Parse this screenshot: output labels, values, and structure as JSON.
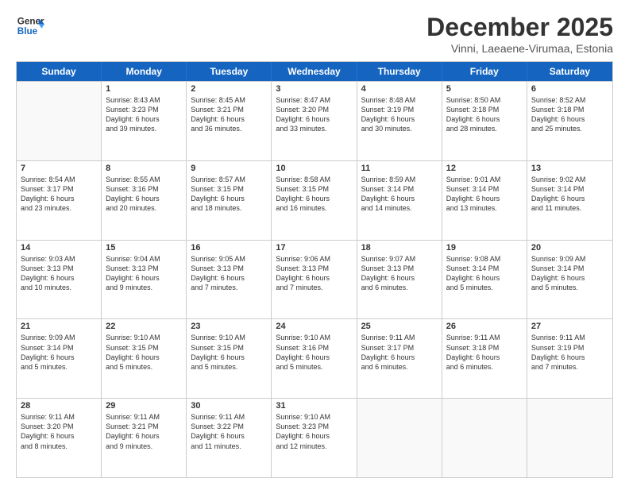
{
  "header": {
    "logo_line1": "General",
    "logo_line2": "Blue",
    "title": "December 2025",
    "subtitle": "Vinni, Laeaene-Virumaa, Estonia"
  },
  "calendar": {
    "weekdays": [
      "Sunday",
      "Monday",
      "Tuesday",
      "Wednesday",
      "Thursday",
      "Friday",
      "Saturday"
    ],
    "rows": [
      [
        {
          "day": "",
          "lines": [],
          "empty": true
        },
        {
          "day": "1",
          "lines": [
            "Sunrise: 8:43 AM",
            "Sunset: 3:23 PM",
            "Daylight: 6 hours",
            "and 39 minutes."
          ]
        },
        {
          "day": "2",
          "lines": [
            "Sunrise: 8:45 AM",
            "Sunset: 3:21 PM",
            "Daylight: 6 hours",
            "and 36 minutes."
          ]
        },
        {
          "day": "3",
          "lines": [
            "Sunrise: 8:47 AM",
            "Sunset: 3:20 PM",
            "Daylight: 6 hours",
            "and 33 minutes."
          ]
        },
        {
          "day": "4",
          "lines": [
            "Sunrise: 8:48 AM",
            "Sunset: 3:19 PM",
            "Daylight: 6 hours",
            "and 30 minutes."
          ]
        },
        {
          "day": "5",
          "lines": [
            "Sunrise: 8:50 AM",
            "Sunset: 3:18 PM",
            "Daylight: 6 hours",
            "and 28 minutes."
          ]
        },
        {
          "day": "6",
          "lines": [
            "Sunrise: 8:52 AM",
            "Sunset: 3:18 PM",
            "Daylight: 6 hours",
            "and 25 minutes."
          ]
        }
      ],
      [
        {
          "day": "7",
          "lines": [
            "Sunrise: 8:54 AM",
            "Sunset: 3:17 PM",
            "Daylight: 6 hours",
            "and 23 minutes."
          ]
        },
        {
          "day": "8",
          "lines": [
            "Sunrise: 8:55 AM",
            "Sunset: 3:16 PM",
            "Daylight: 6 hours",
            "and 20 minutes."
          ]
        },
        {
          "day": "9",
          "lines": [
            "Sunrise: 8:57 AM",
            "Sunset: 3:15 PM",
            "Daylight: 6 hours",
            "and 18 minutes."
          ]
        },
        {
          "day": "10",
          "lines": [
            "Sunrise: 8:58 AM",
            "Sunset: 3:15 PM",
            "Daylight: 6 hours",
            "and 16 minutes."
          ]
        },
        {
          "day": "11",
          "lines": [
            "Sunrise: 8:59 AM",
            "Sunset: 3:14 PM",
            "Daylight: 6 hours",
            "and 14 minutes."
          ]
        },
        {
          "day": "12",
          "lines": [
            "Sunrise: 9:01 AM",
            "Sunset: 3:14 PM",
            "Daylight: 6 hours",
            "and 13 minutes."
          ]
        },
        {
          "day": "13",
          "lines": [
            "Sunrise: 9:02 AM",
            "Sunset: 3:14 PM",
            "Daylight: 6 hours",
            "and 11 minutes."
          ]
        }
      ],
      [
        {
          "day": "14",
          "lines": [
            "Sunrise: 9:03 AM",
            "Sunset: 3:13 PM",
            "Daylight: 6 hours",
            "and 10 minutes."
          ]
        },
        {
          "day": "15",
          "lines": [
            "Sunrise: 9:04 AM",
            "Sunset: 3:13 PM",
            "Daylight: 6 hours",
            "and 9 minutes."
          ]
        },
        {
          "day": "16",
          "lines": [
            "Sunrise: 9:05 AM",
            "Sunset: 3:13 PM",
            "Daylight: 6 hours",
            "and 7 minutes."
          ]
        },
        {
          "day": "17",
          "lines": [
            "Sunrise: 9:06 AM",
            "Sunset: 3:13 PM",
            "Daylight: 6 hours",
            "and 7 minutes."
          ]
        },
        {
          "day": "18",
          "lines": [
            "Sunrise: 9:07 AM",
            "Sunset: 3:13 PM",
            "Daylight: 6 hours",
            "and 6 minutes."
          ]
        },
        {
          "day": "19",
          "lines": [
            "Sunrise: 9:08 AM",
            "Sunset: 3:14 PM",
            "Daylight: 6 hours",
            "and 5 minutes."
          ]
        },
        {
          "day": "20",
          "lines": [
            "Sunrise: 9:09 AM",
            "Sunset: 3:14 PM",
            "Daylight: 6 hours",
            "and 5 minutes."
          ]
        }
      ],
      [
        {
          "day": "21",
          "lines": [
            "Sunrise: 9:09 AM",
            "Sunset: 3:14 PM",
            "Daylight: 6 hours",
            "and 5 minutes."
          ]
        },
        {
          "day": "22",
          "lines": [
            "Sunrise: 9:10 AM",
            "Sunset: 3:15 PM",
            "Daylight: 6 hours",
            "and 5 minutes."
          ]
        },
        {
          "day": "23",
          "lines": [
            "Sunrise: 9:10 AM",
            "Sunset: 3:15 PM",
            "Daylight: 6 hours",
            "and 5 minutes."
          ]
        },
        {
          "day": "24",
          "lines": [
            "Sunrise: 9:10 AM",
            "Sunset: 3:16 PM",
            "Daylight: 6 hours",
            "and 5 minutes."
          ]
        },
        {
          "day": "25",
          "lines": [
            "Sunrise: 9:11 AM",
            "Sunset: 3:17 PM",
            "Daylight: 6 hours",
            "and 6 minutes."
          ]
        },
        {
          "day": "26",
          "lines": [
            "Sunrise: 9:11 AM",
            "Sunset: 3:18 PM",
            "Daylight: 6 hours",
            "and 6 minutes."
          ]
        },
        {
          "day": "27",
          "lines": [
            "Sunrise: 9:11 AM",
            "Sunset: 3:19 PM",
            "Daylight: 6 hours",
            "and 7 minutes."
          ]
        }
      ],
      [
        {
          "day": "28",
          "lines": [
            "Sunrise: 9:11 AM",
            "Sunset: 3:20 PM",
            "Daylight: 6 hours",
            "and 8 minutes."
          ]
        },
        {
          "day": "29",
          "lines": [
            "Sunrise: 9:11 AM",
            "Sunset: 3:21 PM",
            "Daylight: 6 hours",
            "and 9 minutes."
          ]
        },
        {
          "day": "30",
          "lines": [
            "Sunrise: 9:11 AM",
            "Sunset: 3:22 PM",
            "Daylight: 6 hours",
            "and 11 minutes."
          ]
        },
        {
          "day": "31",
          "lines": [
            "Sunrise: 9:10 AM",
            "Sunset: 3:23 PM",
            "Daylight: 6 hours",
            "and 12 minutes."
          ]
        },
        {
          "day": "",
          "lines": [],
          "empty": true
        },
        {
          "day": "",
          "lines": [],
          "empty": true
        },
        {
          "day": "",
          "lines": [],
          "empty": true
        }
      ]
    ]
  }
}
